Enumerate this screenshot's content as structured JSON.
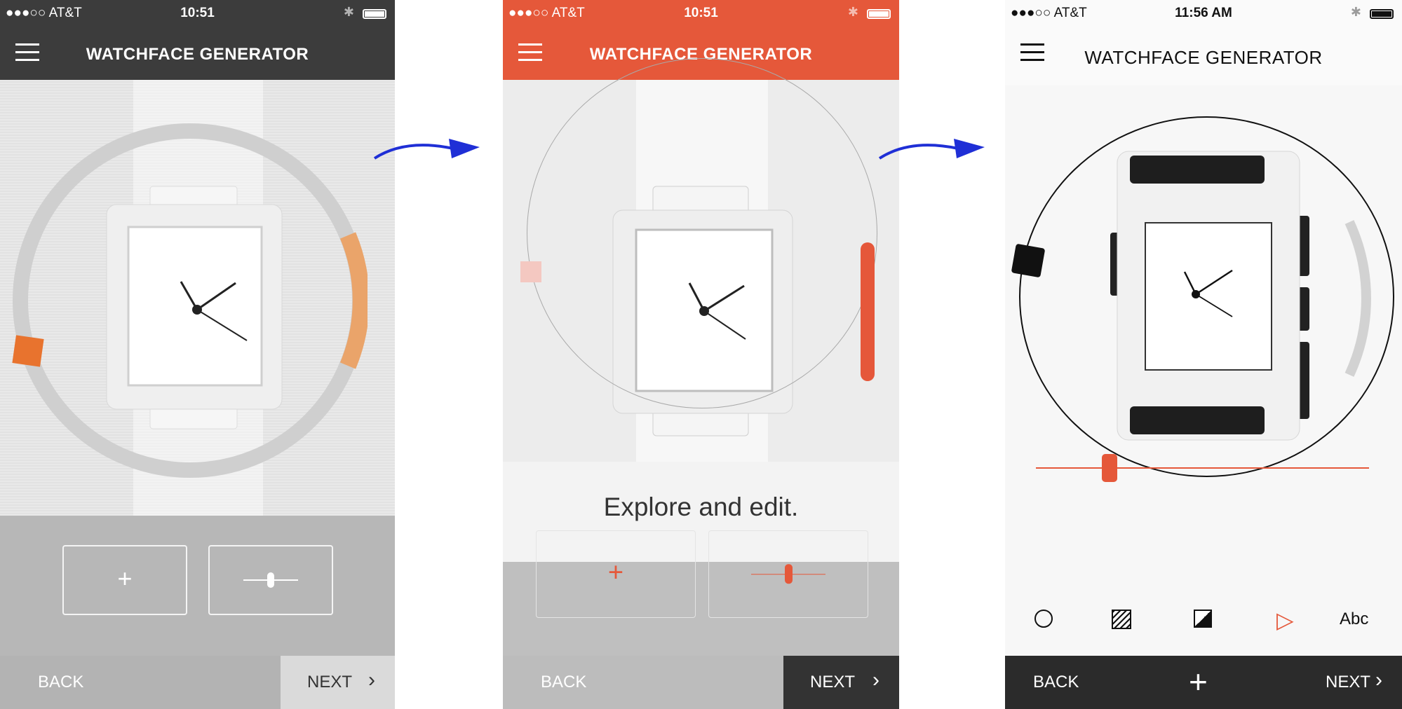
{
  "colors": {
    "accent": "#e5583a",
    "dark_bar": "#3c3c3c",
    "light_bar": "#fafafa",
    "arrow_blue": "#1f2fd6"
  },
  "panels": [
    {
      "status": {
        "carrier": "●●●○○ AT&T",
        "time": "10:51"
      },
      "header": {
        "title": "WATCHFACE GENERATOR"
      },
      "toolbar": {
        "plus_label": "+"
      },
      "footer": {
        "back_label": "BACK",
        "next_label": "NEXT",
        "next_chevron": "›"
      }
    },
    {
      "status": {
        "carrier": "●●●○○ AT&T",
        "time": "10:51"
      },
      "header": {
        "title": "WATCHFACE GENERATOR"
      },
      "caption": "Explore and edit.",
      "toolbar": {
        "plus_label": "+"
      },
      "footer": {
        "back_label": "BACK",
        "next_label": "NEXT",
        "next_chevron": "›"
      }
    },
    {
      "status": {
        "carrier": "●●●○○ AT&T",
        "time": "11:56 AM"
      },
      "header": {
        "title": "WATCHFACE GENERATOR"
      },
      "tools": {
        "text_tool_label": "Abc"
      },
      "footer": {
        "back_label": "BACK",
        "add_label": "+",
        "next_label": "NEXT",
        "next_chevron": "›"
      }
    }
  ]
}
